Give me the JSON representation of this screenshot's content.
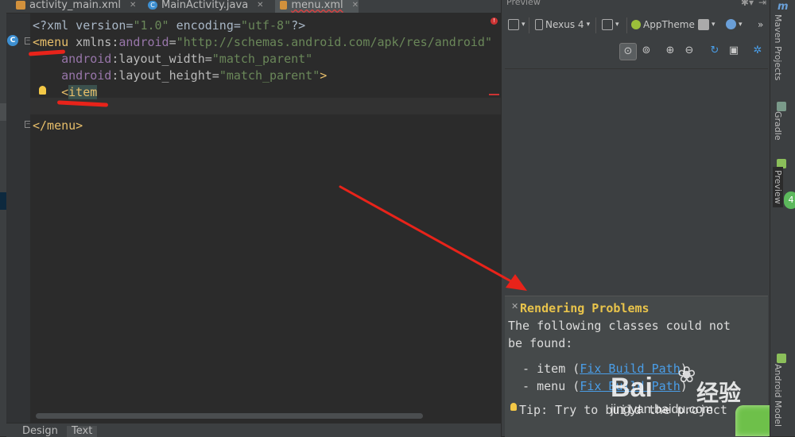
{
  "tabs": [
    {
      "label": "activity_main.xml",
      "icon": "xml-file-icon"
    },
    {
      "label": "MainActivity.java",
      "icon": "java-class-icon"
    },
    {
      "label": "menu.xml",
      "icon": "xml-file-icon",
      "active": true
    }
  ],
  "editor": {
    "lines": {
      "l1_a": "<?xml version=",
      "l1_b": "\"1.0\"",
      "l1_c": " encoding=",
      "l1_d": "\"utf-8\"",
      "l1_e": "?>",
      "l2_tag": "<menu",
      "l2_space": " xmlns:",
      "l2_ns": "android",
      "l2_eq": "=",
      "l2_str": "\"http://schemas.android.com/apk/res/android\"",
      "l3_ns": "android",
      "l3_attr": ":layout_width=",
      "l3_str": "\"match_parent\"",
      "l4_ns": "android",
      "l4_attr": ":layout_height=",
      "l4_str": "\"match_parent\"",
      "l4_end": ">",
      "l5_lt": "<",
      "l5_tag": "item",
      "l7_close": "</menu>"
    },
    "gutter_badge": "C",
    "error_indicator": "!"
  },
  "bottom_tabs": {
    "design": "Design",
    "text": "Text"
  },
  "preview": {
    "title": "Preview",
    "toolbar": {
      "device": "Nexus 4",
      "theme": "AppTheme",
      "more": "»"
    },
    "problems": {
      "title": "Rendering Problems",
      "line1": "The following classes could not",
      "line2": "be found:",
      "item1_prefix": "  - item (",
      "item1_link": "Fix Build Path",
      "item1_suffix": ")",
      "item2_prefix": "  - menu (",
      "item2_link": "Fix Build Path",
      "item2_suffix": ")",
      "tip": "Tip: Try to build the project"
    }
  },
  "right_tools": {
    "maven": "Maven Projects",
    "gradle": "Gradle",
    "preview": "Preview",
    "android": "Android Model",
    "badge": "4"
  },
  "watermark": {
    "brand": "Bai",
    "brand_cn": "经验",
    "url": "jingyan.baidu.com"
  },
  "colors": {
    "editor_bg": "#2b2b2b",
    "tag": "#e8bf6a",
    "string": "#6a8759",
    "namespace": "#9876aa",
    "annotation_red": "#e8231a",
    "problem_title": "#e8c34b",
    "link": "#4a9ee8"
  }
}
